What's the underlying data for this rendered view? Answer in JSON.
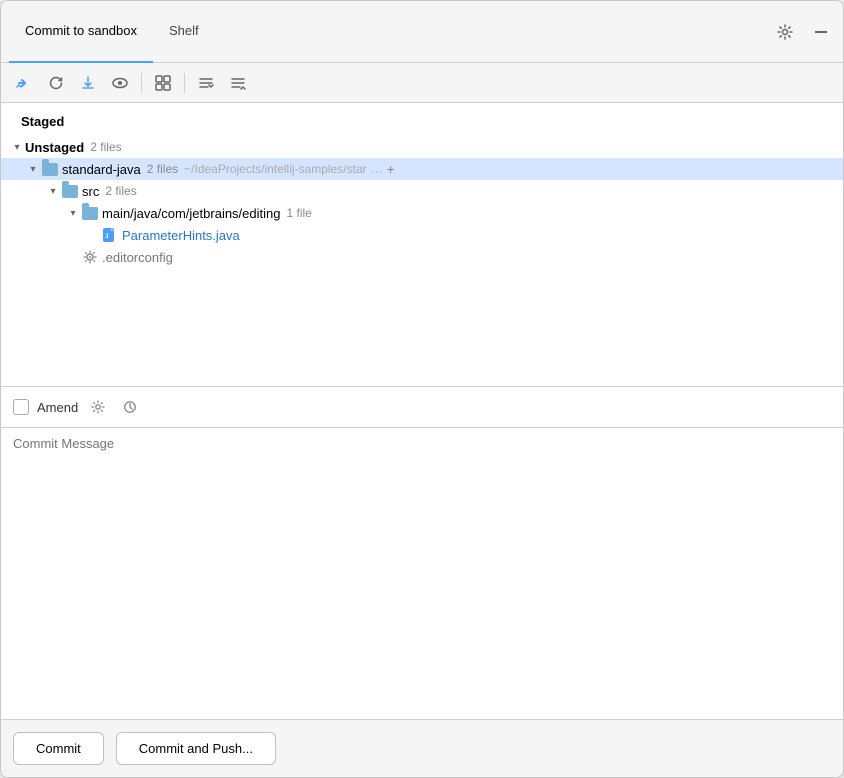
{
  "tabs": [
    {
      "id": "commit",
      "label": "Commit to sandbox",
      "active": true
    },
    {
      "id": "shelf",
      "label": "Shelf",
      "active": false
    }
  ],
  "toolbar": {
    "buttons": [
      {
        "id": "add",
        "icon": "plus-arrow",
        "title": "Add"
      },
      {
        "id": "refresh",
        "icon": "refresh",
        "title": "Refresh"
      },
      {
        "id": "update",
        "icon": "download-arrow",
        "title": "Update"
      },
      {
        "id": "view",
        "icon": "eye",
        "title": "View"
      },
      {
        "id": "split",
        "icon": "grid",
        "title": "Split"
      },
      {
        "id": "expand",
        "icon": "expand",
        "title": "Expand All"
      },
      {
        "id": "collapse",
        "icon": "collapse",
        "title": "Collapse All"
      }
    ]
  },
  "tree": {
    "staged_label": "Staged",
    "unstaged_label": "Unstaged",
    "unstaged_count": "2 files",
    "repo": {
      "name": "standard-java",
      "count": "2 files",
      "path": "~/IdeaProjects/intellij-samples/star",
      "children": {
        "src": {
          "name": "src",
          "count": "2 files",
          "children": {
            "main_path": {
              "name": "main/java/com/jetbrains/editing",
              "count": "1 file",
              "children": {
                "java_file": {
                  "name": "ParameterHints.java"
                }
              }
            },
            "editorconfig": {
              "name": ".editorconfig"
            }
          }
        }
      }
    }
  },
  "amend": {
    "label": "Amend",
    "checked": false
  },
  "commit_message": {
    "placeholder": "Commit Message"
  },
  "buttons": {
    "commit": "Commit",
    "commit_and_push": "Commit and Push..."
  }
}
